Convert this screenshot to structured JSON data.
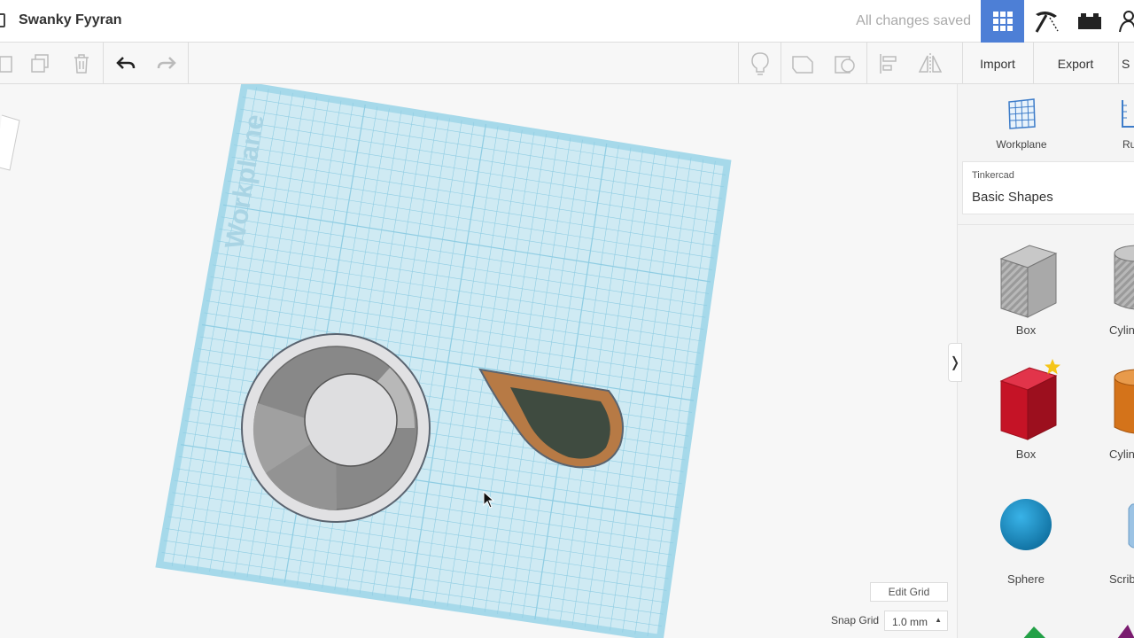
{
  "header": {
    "title": "Swanky Fyyran",
    "save_status": "All changes saved",
    "nav": [
      {
        "icon": "grid-view-icon",
        "active": true
      },
      {
        "icon": "pickaxe-icon",
        "active": false
      },
      {
        "icon": "bricks-icon",
        "active": false
      },
      {
        "icon": "user-icon",
        "active": false
      }
    ]
  },
  "toolbar": {
    "import_label": "Import",
    "export_label": "Export",
    "share_label": "S"
  },
  "workplane": {
    "watermark": "Workplane"
  },
  "panel": {
    "workplane_label": "Workplane",
    "ruler_label": "Ru",
    "library_source": "Tinkercad",
    "library_name": "Basic Shapes",
    "shapes": [
      {
        "label": "Box",
        "style": "striped",
        "color": "#b5b5b5"
      },
      {
        "label": "Cylin",
        "style": "striped",
        "color": "#b5b5b5"
      },
      {
        "label": "Box",
        "style": "solid",
        "color": "#cc1526",
        "favorite": true
      },
      {
        "label": "Cylin",
        "style": "solid",
        "color": "#d97a1c"
      },
      {
        "label": "Sphere",
        "style": "solid",
        "color": "#1a8fc9"
      },
      {
        "label": "Scrib",
        "style": "solid",
        "color": "#8fb8dd"
      }
    ]
  },
  "grid_controls": {
    "edit_grid_label": "Edit Grid",
    "snap_grid_label": "Snap Grid",
    "snap_grid_value": "1.0 mm"
  },
  "colors": {
    "accent": "#4d7fd6",
    "workplane": "#cfeaf3",
    "workplane_grid": "#8fcde3"
  }
}
